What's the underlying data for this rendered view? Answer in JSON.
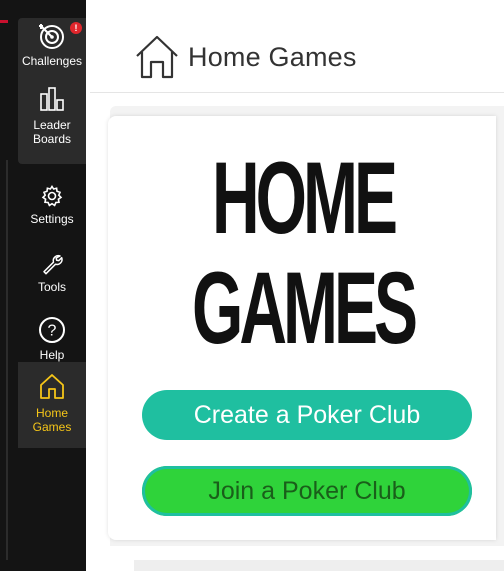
{
  "sidebar": {
    "items": [
      {
        "id": "challenges",
        "label": "Challenges",
        "icon": "target-icon",
        "badge": "!"
      },
      {
        "id": "leaderboards",
        "label": "Leader\nBoards",
        "label_line1": "Leader",
        "label_line2": "Boards",
        "icon": "bar-chart-icon"
      },
      {
        "id": "settings",
        "label": "Settings",
        "icon": "gear-icon"
      },
      {
        "id": "tools",
        "label": "Tools",
        "icon": "wrench-icon"
      },
      {
        "id": "help",
        "label": "Help",
        "icon": "question-icon"
      },
      {
        "id": "homegames",
        "label_line1": "Home",
        "label_line2": "Games",
        "icon": "house-icon",
        "active": true
      }
    ]
  },
  "header": {
    "title": "Home Games",
    "icon": "house-icon"
  },
  "logo": {
    "line1": "HOME",
    "line2": "GAMES"
  },
  "buttons": {
    "create": "Create a Poker Club",
    "join": "Join a Poker Club"
  },
  "colors": {
    "sidebar_bg": "#141414",
    "active_accent": "#f5c518",
    "create_button": "#1fbfa0",
    "join_button": "#2fd33a",
    "badge": "#e0262c"
  }
}
